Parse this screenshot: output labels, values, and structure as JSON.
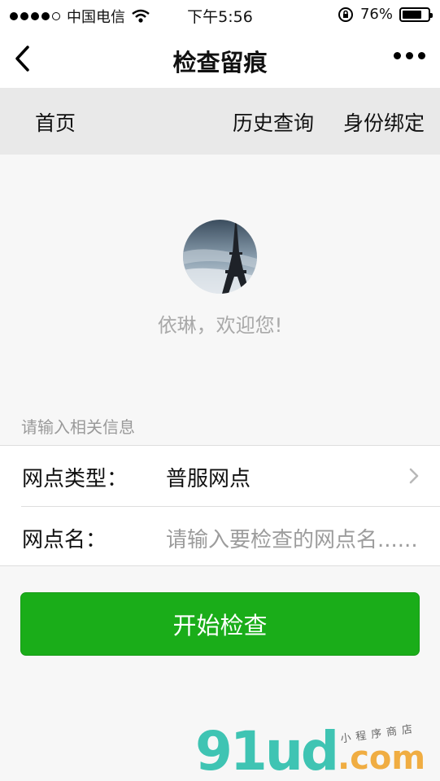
{
  "status_bar": {
    "carrier": "中国电信",
    "time": "下午5:56",
    "battery": "76%",
    "battery_level": 0.76,
    "icons": [
      "signal-dots-icon",
      "wifi-icon",
      "rotation-lock-icon",
      "battery-icon"
    ]
  },
  "nav": {
    "title": "检查留痕",
    "back_icon": "chevron-left-icon",
    "more_icon": "more-dots-icon"
  },
  "tabs": [
    {
      "label": "首页"
    },
    {
      "label": "历史查询"
    },
    {
      "label": "身份绑定"
    }
  ],
  "profile": {
    "avatar": "eiffel-tower-photo",
    "greeting": "依琳，欢迎您!"
  },
  "form": {
    "section_label": "请输入相关信息",
    "outlet_type_label": "网点类型：",
    "outlet_type_value": "普服网点",
    "outlet_name_label": "网点名：",
    "outlet_name_placeholder": "请输入要检查的网点名......"
  },
  "button": {
    "start_label": "开始检查",
    "color": "#1aad19"
  },
  "watermark": {
    "main": "91ud",
    "suffix": ".com",
    "tag": "小程序商店"
  }
}
